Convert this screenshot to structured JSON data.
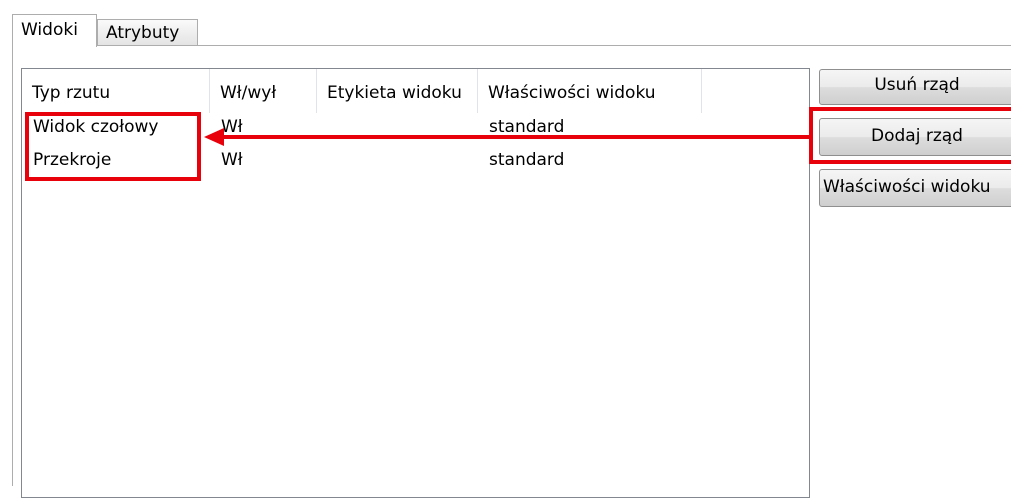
{
  "tabs": [
    {
      "label": "Widoki",
      "active": true
    },
    {
      "label": "Atrybuty",
      "active": false
    }
  ],
  "table": {
    "columns": [
      "Typ rzutu",
      "Wł/wył",
      "Etykieta widoku",
      "Właściwości widoku",
      ""
    ],
    "rows": [
      {
        "type": "Widok czołowy",
        "onoff": "Wł",
        "label": "",
        "properties": "standard"
      },
      {
        "type": "Przekroje",
        "onoff": "Wł",
        "label": "",
        "properties": "standard"
      }
    ]
  },
  "buttons": {
    "remove_row": "Usuń rząd",
    "add_row": "Dodaj rząd",
    "view_properties": "Właściwości widoku"
  },
  "annotation": {
    "color": "#e8000b"
  }
}
